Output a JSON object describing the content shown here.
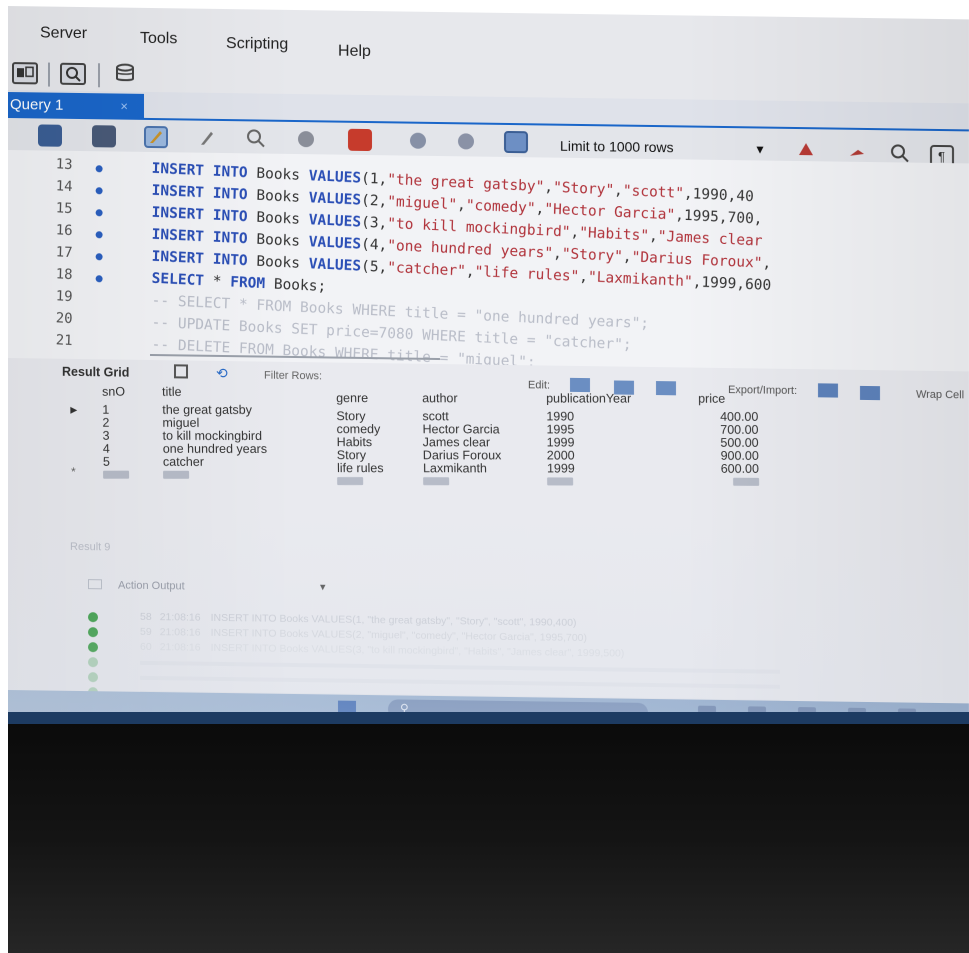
{
  "menu": [
    "Server",
    "Tools",
    "Scripting",
    "Help"
  ],
  "tab": {
    "label": "Query 1",
    "close": "×"
  },
  "editor_toolbar": {
    "limit": "Limit to 1000 rows"
  },
  "editor": {
    "lines": [
      {
        "n": "13",
        "marker": true,
        "parts": [
          [
            "kw",
            "INSERT INTO"
          ],
          [
            "plain",
            " Books "
          ],
          [
            "kw",
            "VALUES"
          ],
          [
            "plain",
            "(1,"
          ],
          [
            "str",
            "\"the great gatsby\""
          ],
          [
            "plain",
            ","
          ],
          [
            "str",
            "\"Story\""
          ],
          [
            "plain",
            ","
          ],
          [
            "str",
            "\"scott\""
          ],
          [
            "plain",
            ",1990,40"
          ]
        ]
      },
      {
        "n": "14",
        "marker": true,
        "parts": [
          [
            "kw",
            "INSERT INTO"
          ],
          [
            "plain",
            " Books "
          ],
          [
            "kw",
            "VALUES"
          ],
          [
            "plain",
            "(2,"
          ],
          [
            "str",
            "\"miguel\""
          ],
          [
            "plain",
            ","
          ],
          [
            "str",
            "\"comedy\""
          ],
          [
            "plain",
            ","
          ],
          [
            "str",
            "\"Hector Garcia\""
          ],
          [
            "plain",
            ",1995,700,"
          ]
        ]
      },
      {
        "n": "15",
        "marker": true,
        "parts": [
          [
            "kw",
            "INSERT INTO"
          ],
          [
            "plain",
            " Books "
          ],
          [
            "kw",
            "VALUES"
          ],
          [
            "plain",
            "(3,"
          ],
          [
            "str",
            "\"to kill mockingbird\""
          ],
          [
            "plain",
            ","
          ],
          [
            "str",
            "\"Habits\""
          ],
          [
            "plain",
            ","
          ],
          [
            "str",
            "\"James clear"
          ]
        ]
      },
      {
        "n": "16",
        "marker": true,
        "parts": [
          [
            "kw",
            "INSERT INTO"
          ],
          [
            "plain",
            " Books "
          ],
          [
            "kw",
            "VALUES"
          ],
          [
            "plain",
            "(4,"
          ],
          [
            "str",
            "\"one hundred years\""
          ],
          [
            "plain",
            ","
          ],
          [
            "str",
            "\"Story\""
          ],
          [
            "plain",
            ","
          ],
          [
            "str",
            "\"Darius Foroux\""
          ],
          [
            "plain",
            ","
          ]
        ]
      },
      {
        "n": "17",
        "marker": true,
        "parts": [
          [
            "kw",
            "INSERT INTO"
          ],
          [
            "plain",
            " Books "
          ],
          [
            "kw",
            "VALUES"
          ],
          [
            "plain",
            "(5,"
          ],
          [
            "str",
            "\"catcher\""
          ],
          [
            "plain",
            ","
          ],
          [
            "str",
            "\"life rules\""
          ],
          [
            "plain",
            ","
          ],
          [
            "str",
            "\"Laxmikanth\""
          ],
          [
            "plain",
            ",1999,600"
          ]
        ]
      },
      {
        "n": "18",
        "marker": true,
        "parts": [
          [
            "kw",
            "SELECT"
          ],
          [
            "plain",
            " * "
          ],
          [
            "kw",
            "FROM"
          ],
          [
            "plain",
            " Books;"
          ]
        ]
      },
      {
        "n": "19",
        "marker": false,
        "parts": [
          [
            "cmt",
            "-- SELECT * FROM Books WHERE title = \"one hundred years\";"
          ]
        ]
      },
      {
        "n": "20",
        "marker": false,
        "parts": [
          [
            "cmt",
            "-- UPDATE Books SET price=7080  WHERE title = \"catcher\";"
          ]
        ]
      },
      {
        "n": "21",
        "marker": false,
        "parts": [
          [
            "cmt",
            "-- DELETE FROM Books WHERE title = \"miguel\";"
          ]
        ]
      }
    ]
  },
  "result_bar": {
    "result_grid": "Result Grid",
    "filter": "Filter Rows:",
    "edit": "Edit:",
    "export": "Export/Import:",
    "wrap": "Wrap Cell"
  },
  "grid": {
    "columns": [
      "snO",
      "title",
      "genre",
      "author",
      "publicationYear",
      "price"
    ],
    "rows": [
      [
        "1",
        "the great gatsby",
        "Story",
        "scott",
        "1990",
        "400.00"
      ],
      [
        "2",
        "miguel",
        "comedy",
        "Hector Garcia",
        "1995",
        "700.00"
      ],
      [
        "3",
        "to kill mockingbird",
        "Habits",
        "James clear",
        "1999",
        "500.00"
      ],
      [
        "4",
        "one hundred years",
        "Story",
        "Darius Foroux",
        "2000",
        "900.00"
      ],
      [
        "5",
        "catcher",
        "life rules",
        "Laxmikanth",
        "1999",
        "600.00"
      ]
    ]
  },
  "output": {
    "result_tab": "Result 9",
    "label": "Action Output",
    "rows": [
      {
        "num": "58",
        "time": "21:08:16",
        "action": "INSERT INTO Books VALUES(1, \"the great gatsby\", \"Story\", \"scott\", 1990,400)"
      },
      {
        "num": "59",
        "time": "21:08:16",
        "action": "INSERT INTO Books VALUES(2, \"miguel\", \"comedy\", \"Hector Garcia\", 1995,700)"
      },
      {
        "num": "60",
        "time": "21:08:16",
        "action": "INSERT INTO Books VALUES(3, \"to kill mockingbird\", \"Habits\", \"James clear\", 1999,500)"
      }
    ]
  }
}
